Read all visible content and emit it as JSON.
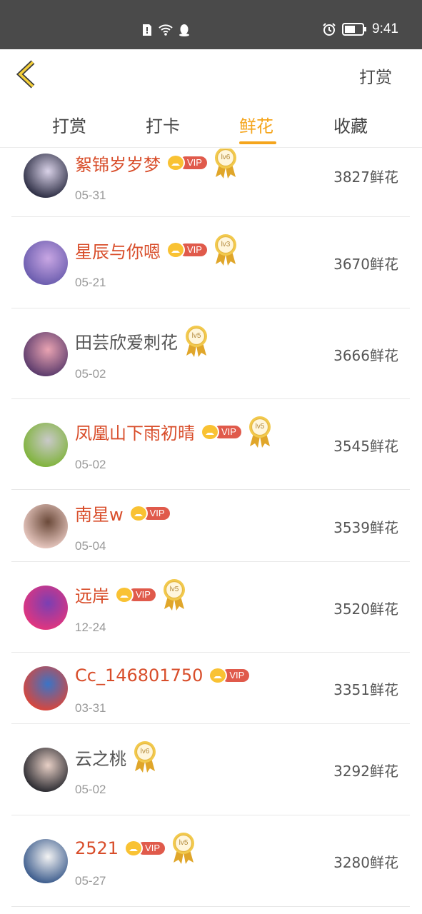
{
  "status_bar": {
    "time": "9:41"
  },
  "header": {
    "right_action": "打赏"
  },
  "tabs": [
    {
      "label": "打赏",
      "active": false
    },
    {
      "label": "打卡",
      "active": false
    },
    {
      "label": "鲜花",
      "active": true
    },
    {
      "label": "收藏",
      "active": false
    }
  ],
  "vip_label": "VIP",
  "rows": [
    {
      "name": "絮锦岁岁梦",
      "vip": true,
      "level": "lv6",
      "date": "05-31",
      "flowers": "3827鲜花",
      "avatar_colors": [
        "#2c2d43",
        "#d9d2e8"
      ]
    },
    {
      "name": "星辰与你嗯",
      "vip": true,
      "level": "lv3",
      "date": "05-21",
      "flowers": "3670鲜花",
      "avatar_colors": [
        "#6a5cae",
        "#c8a6e3"
      ]
    },
    {
      "name": "田芸欣爱刺花",
      "vip": false,
      "level": "lv5",
      "date": "05-02",
      "flowers": "3666鲜花",
      "avatar_colors": [
        "#5a3a6b",
        "#e9a3b2"
      ]
    },
    {
      "name": "凤凰山下雨初晴",
      "vip": true,
      "level": "lv5",
      "date": "05-02",
      "flowers": "3545鲜花",
      "avatar_colors": [
        "#7fb33a",
        "#c9c9c9"
      ]
    },
    {
      "name": "南星w",
      "vip": true,
      "level": "",
      "date": "05-04",
      "flowers": "3539鲜花",
      "avatar_colors": [
        "#e8c8c0",
        "#6b4a3a"
      ]
    },
    {
      "name": "远岸",
      "vip": true,
      "level": "lv5",
      "date": "12-24",
      "flowers": "3520鲜花",
      "avatar_colors": [
        "#e2357e",
        "#7a3fb3"
      ]
    },
    {
      "name": "Cc_146801750",
      "vip": true,
      "level": "",
      "date": "03-31",
      "flowers": "3351鲜花",
      "avatar_colors": [
        "#d9463b",
        "#3a74c7"
      ]
    },
    {
      "name": "云之桃",
      "vip": false,
      "level": "lv6",
      "date": "05-02",
      "flowers": "3292鲜花",
      "avatar_colors": [
        "#2a2a30",
        "#e8d0c6"
      ]
    },
    {
      "name": "2521",
      "vip": true,
      "level": "lv5",
      "date": "05-27",
      "flowers": "3280鲜花",
      "avatar_colors": [
        "#3b5b8c",
        "#f3f3f3"
      ]
    }
  ],
  "colors": {
    "accent": "#f5a51c",
    "vip_name": "#d84d2a",
    "status_bar": "#4a4a4a"
  }
}
